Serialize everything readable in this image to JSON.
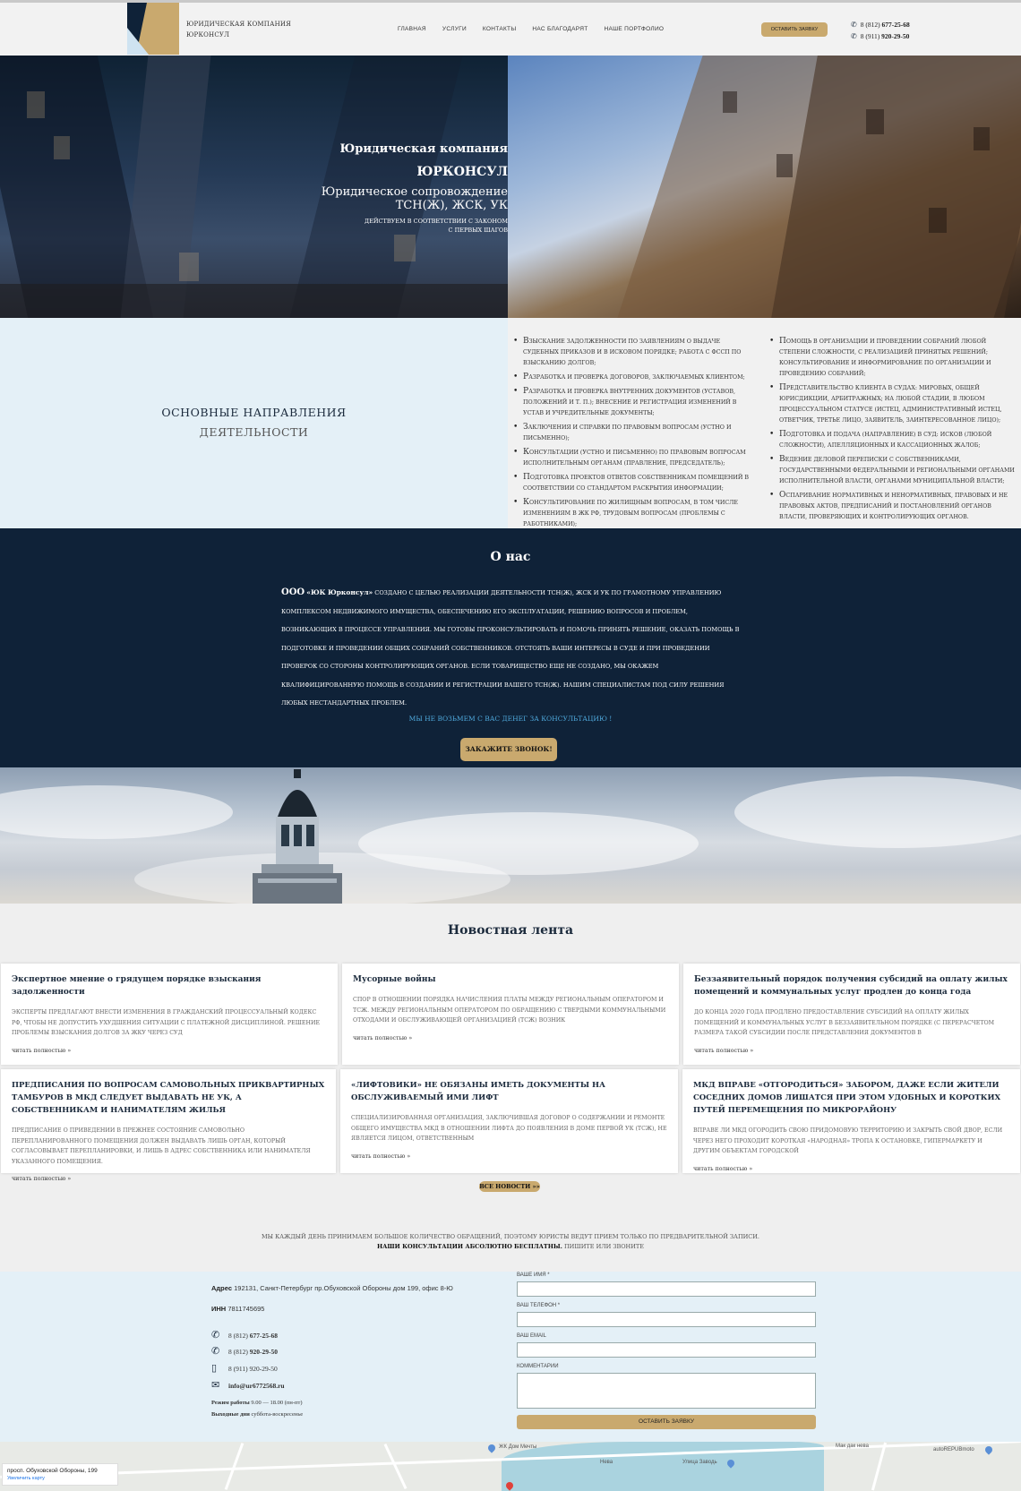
{
  "header": {
    "logo_text_line1": "ЮРИДИЧЕСКАЯ КОМПАНИЯ",
    "logo_text_line2": "ЮРКОНСУЛ",
    "nav": [
      "ГЛАВНАЯ",
      "УСЛУГИ",
      "КОНТАКТЫ",
      "НАС БЛАГОДАРЯТ",
      "НАШЕ ПОРТФОЛИО"
    ],
    "cta_button": "ОСТАВИТЬ ЗАЯВКУ",
    "phone1_prefix": "8 (812) ",
    "phone1_number": "677-25-68",
    "phone2_prefix": "8 (911) ",
    "phone2_number": "920-29-50"
  },
  "hero": {
    "title_line1": "Юридическая компания",
    "title_line2": "ЮРКОНСУЛ",
    "subtitle_line1": "Юридическое сопровождение",
    "subtitle_line2": "ТСН(Ж), ЖСК, УК",
    "small_line1": "действуем в соответствии с законом",
    "small_line2": "с первых шагов"
  },
  "directions": {
    "title_line1": "ОСНОВНЫЕ НАПРАВЛЕНИЯ",
    "title_line2": "ДЕЯТЕЛЬНОСТИ",
    "col1": [
      {
        "first": "В",
        "rest": "зыскание задолженности по заявлениям о выдаче судебных приказов и в исковом порядке; работа с ФССП по взысканию долгов;"
      },
      {
        "first": "Р",
        "rest": "азработка и проверка договоров, заключаемых клиентом;"
      },
      {
        "first": "Р",
        "rest": "азработка и проверка внутренних документов (уставов, положений и т. п.); внесение и регистрация изменений в Устав и учредительные документы;"
      },
      {
        "first": "З",
        "rest": "аключения и справки по правовым вопросам (устно и письменно);"
      },
      {
        "first": "К",
        "rest": "онсультации (устно и письменно) по правовым вопросам исполнительным органам (правление, председатель);"
      },
      {
        "first": "П",
        "rest": "одготовка проектов ответов собственникам помещений в соответствии со стандартом раскрытия информации;"
      },
      {
        "first": "К",
        "rest": "онсультирование по жилищным вопросам, в том числе изменениям в ЖК РФ, трудовым вопросам (проблемы с работниками);"
      }
    ],
    "col2": [
      {
        "first": "П",
        "rest": "омощь в организации и проведении собраний любой степени сложности, с реализацией принятых решений; консультирование и информирование по организации и проведению собраний;"
      },
      {
        "first": "П",
        "rest": "редставительство клиента в судах: мировых, общей юрисдикции, арбитражных; на любой стадии, в любом процессуальном статусе (истец, административный истец, ответчик, третье лицо, заявитель, заинтересованное лицо);"
      },
      {
        "first": "П",
        "rest": "одготовка и подача (направление) в суд: исков (любой сложности), апелляционных и кассационных жалоб;"
      },
      {
        "first": "В",
        "rest": "едение деловой переписки с собственниками, государственными федеральными и региональными органами исполнительной власти, органами муниципальной власти;"
      },
      {
        "first": "О",
        "rest": "спаривание нормативных и ненормативных, правовых и не правовых актов, предписаний и постановлений органов власти, проверяющих и контролирующих органов."
      }
    ]
  },
  "about": {
    "title": "О нас",
    "lead": "ООО",
    "company": "«ЮК Юрконсул»",
    "text": " создано с целью реализации деятельности ТСН(Ж), ЖСК и УК по грамотному управлению комплексом недвижимого имущества, обеспечению его эксплуатации, решению вопросов и проблем, возникающих в процессе управления. Мы готовы проконсультировать и помочь принять решение, оказать помощь в подготовке и проведении общих собраний собственников. Отстоять Ваши интересы в суде и при проведении проверок со стороны контролирующих органов. Если товарищество еще не создано, мы окажем квалифицированную помощь в создании и регистрации Вашего ТСН(Ж). Нашим специалистам под силу решения любых нестандартных проблем.",
    "free_note": "Мы не возьмем с вас денег за консультацию !",
    "call_button": "ЗАКАЖИТЕ ЗВОНОК!"
  },
  "news": {
    "title": "Новостная лента",
    "more_label": "читать полностью »",
    "all_button": "все новости »»",
    "items": [
      {
        "title": "Экспертное мнение о грядущем порядке взыскания задолженности",
        "text": "Эксперты предлагают внести изменения в Гражданский процессуальный кодекс РФ, чтобы не допустить ухудшения ситуации с платежной дисциплиной. Решение проблемы взыскания долгов за ЖКУ через суд"
      },
      {
        "title": "Мусорные войны",
        "text": "Спор в отношении порядка начисления платы между региональным оператором и ТСЖ. Между региональным оператором по обращению с твердыми коммунальными отходами и обслуживающей организацией (ТСЖ) возник"
      },
      {
        "title": "Беззаявительный порядок получения субсидий на оплату жилых помещений и коммунальных услуг продлен до конца года",
        "text": "До конца 2020 года продлено предоставление субсидий на оплату жилых помещений и коммунальных услуг в беззаявительном порядке (с перерасчетом размера такой субсидии после представления документов в"
      },
      {
        "title": "Предписания по вопросам самовольных приквартирных тамбуров в МКД следует выдавать не УК, а собственникам и нанимателям жилья",
        "text": "Предписание о приведении в прежнее состояние самовольно перепланированного помещения должен выдавать лишь орган, который согласовывает перепланировки, и лишь в адрес собственника или нанимателя указанного помещения."
      },
      {
        "title": "«Лифтовики» не обязаны иметь документы на обслуживаемый ими лифт",
        "text": "Специализированная организация, заключившая договор о содержании и ремонте общего имущества МКД в отношении лифта до появления в доме первой УК (ТСЖ), не является лицом, ответственным"
      },
      {
        "title": "МКД вправе «отгородиться» забором, даже если жители соседних домов лишатся при этом удобных и коротких путей перемещения по микрорайону",
        "text": "Вправе ли МКД огородить свою придомовую территорию и закрыть свой двор, если через него проходит короткая «народная» тропа к остановке, гипермаркету и другим объектам городской"
      }
    ]
  },
  "notice": {
    "line1": "Мы каждый день принимаем большое количество обращений, поэтому юристы ведут прием только по предварительной записи.",
    "line2_bold": "Наши консультации абсолютно бесплатны.",
    "line2_rest": " Пишите или звоните"
  },
  "contacts": {
    "address_label": "Адрес",
    "address": " 192131, Санкт-Петербург пр.Обуховской Обороны дом 199, офис 8-Ю",
    "inn_label": "ИНН",
    "inn": " 7811745695",
    "phone1_prefix": "8 (812) ",
    "phone1_number": "677-25-68",
    "phone2_prefix": "8 (812) ",
    "phone2_number": "920-29-50",
    "phone3": "8 (911) 920-29-50",
    "email": "info@ur6772568.ru",
    "hours_label": "Режим работы",
    "hours": " 9.00 — 18.00 (пн-пт)",
    "days_off_label": "Выходные дни",
    "days_off": " суббота-воскресенье"
  },
  "form": {
    "name_label": "Ваше имя *",
    "phone_label": "Ваш телефон *",
    "email_label": "Ваш email",
    "comment_label": "Комментарии",
    "submit": "оставить заявку"
  },
  "map": {
    "address": "просп. Обуховской Обороны, 199",
    "enlarge_link": "Увеличить карту",
    "label_park": "ЖК Дом Мечты",
    "label_neva": "Нева",
    "label_zavod": "Улица Заводь",
    "label_poi1": "Мак дак нева",
    "label_poi2": "autoREPUBmoto"
  },
  "colors": {
    "navy": "#0f2238",
    "gold": "#c9a96e",
    "light_blue": "#e4f0f7",
    "link_blue": "#4fa9dc"
  }
}
